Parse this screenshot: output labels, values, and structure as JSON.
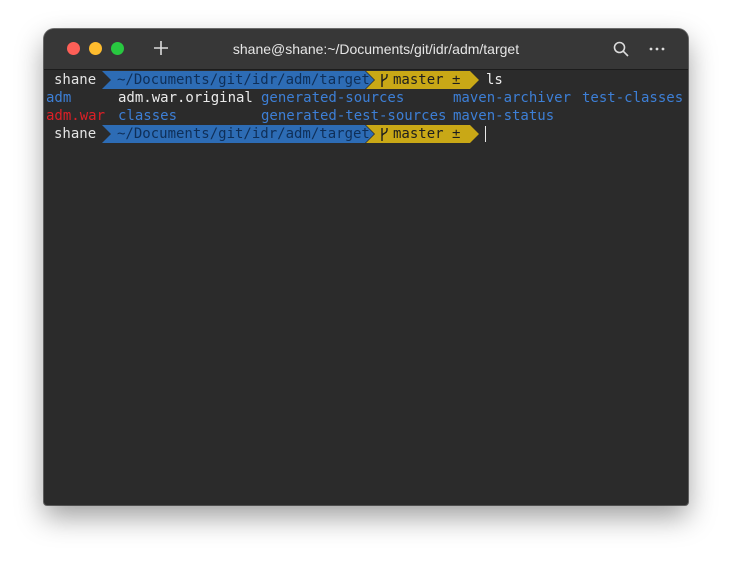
{
  "window": {
    "title": "shane@shane:~/Documents/git/idr/adm/target"
  },
  "toolbar": {
    "icons": [
      "close",
      "minimize",
      "maximize",
      "new-tab-plus-icon",
      "search-icon",
      "more-icon"
    ]
  },
  "prompt": {
    "user": "shane",
    "path": "~/Documents/git/idr/adm/target",
    "branch": "master ±"
  },
  "history": {
    "command": "ls"
  },
  "listing": {
    "row1": [
      "adm",
      "adm.war.original",
      "generated-sources",
      "maven-archiver",
      "test-classes"
    ],
    "row2": [
      "adm.war",
      "classes",
      "generated-test-sources",
      "maven-status"
    ]
  },
  "colors": {
    "path_segment": "#2d6cb5",
    "git_segment": "#c9a816",
    "directory": "#3d7fd6",
    "archive": "#dd1f26",
    "background": "#2b2b2b"
  }
}
